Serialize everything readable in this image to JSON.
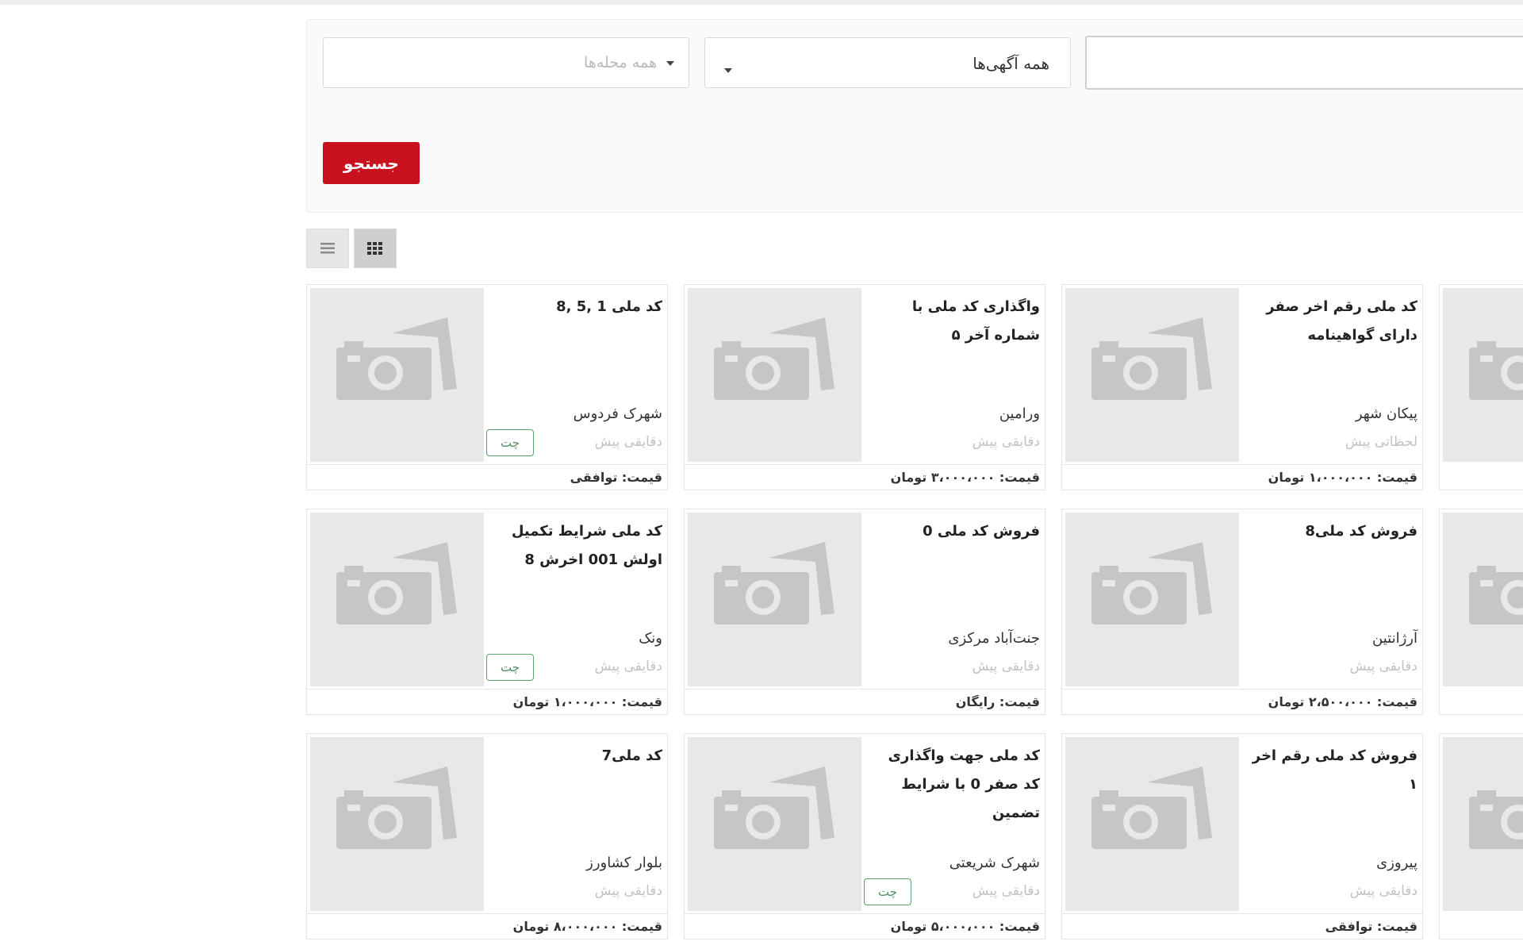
{
  "search": {
    "neighborhood_placeholder": "همه محله‌ها",
    "category_value": "همه آگهی‌ها",
    "keyword_value": "",
    "button_label": "جستجو"
  },
  "view": {
    "list_icon": "list-icon",
    "grid_icon": "grid-icon",
    "active": "grid"
  },
  "listings": [
    {
      "title": "کد ملی رقم اخر صفر دارای گواهینامه",
      "location": "پیکان شهر",
      "time": "لحظاتی پیش",
      "price": "قیمت: ۱،۰۰۰،۰۰۰ تومان",
      "chat": ""
    },
    {
      "title": "واگذاری کد ملی با شماره آخر ۵",
      "location": "ورامین",
      "time": "دقایقی پیش",
      "price": "قیمت: ۳،۰۰۰،۰۰۰ تومان",
      "chat": ""
    },
    {
      "title": "کد ملی 1 ,5 ,8",
      "location": "شهرک فردوس",
      "time": "دقایقی پیش",
      "price": "قیمت: توافقی",
      "chat": "چت"
    },
    {
      "title": "فروش کد ملی8",
      "location": "آرژانتین",
      "time": "دقایقی پیش",
      "price": "قیمت: ۲،۵۰۰،۰۰۰ تومان",
      "chat": ""
    },
    {
      "title": "فروش کد ملی 0",
      "location": "جنت‌آباد مرکزی",
      "time": "دقایقی پیش",
      "price": "قیمت: رایگان",
      "chat": ""
    },
    {
      "title": "کد ملی شرایط تکمیل اولش 001 اخرش 8",
      "location": "ونک",
      "time": "دقایقی پیش",
      "price": "قیمت: ۱،۰۰۰،۰۰۰ تومان",
      "chat": "چت"
    },
    {
      "title": "فروش کد ملی رقم اخر ۱",
      "location": "پیروزی",
      "time": "دقایقی پیش",
      "price": "قیمت: توافقی",
      "chat": ""
    },
    {
      "title": "کد ملی جهت واگذاری کد صفر 0 با شرایط تضمین",
      "location": "شهرک شریعتی",
      "time": "دقایقی پیش",
      "price": "قیمت: ۵،۰۰۰،۰۰۰ تومان",
      "chat": "چت"
    },
    {
      "title": "کد ملی7",
      "location": "بلوار کشاورز",
      "time": "دقایقی پیش",
      "price": "قیمت: ۸،۰۰۰،۰۰۰ تومان",
      "chat": ""
    }
  ],
  "placeholder_image_icon": "camera-icon",
  "colors": {
    "accent_red": "#c8101f",
    "chat_green": "#5aa36d",
    "thumb_gray": "#e8e8e8"
  }
}
